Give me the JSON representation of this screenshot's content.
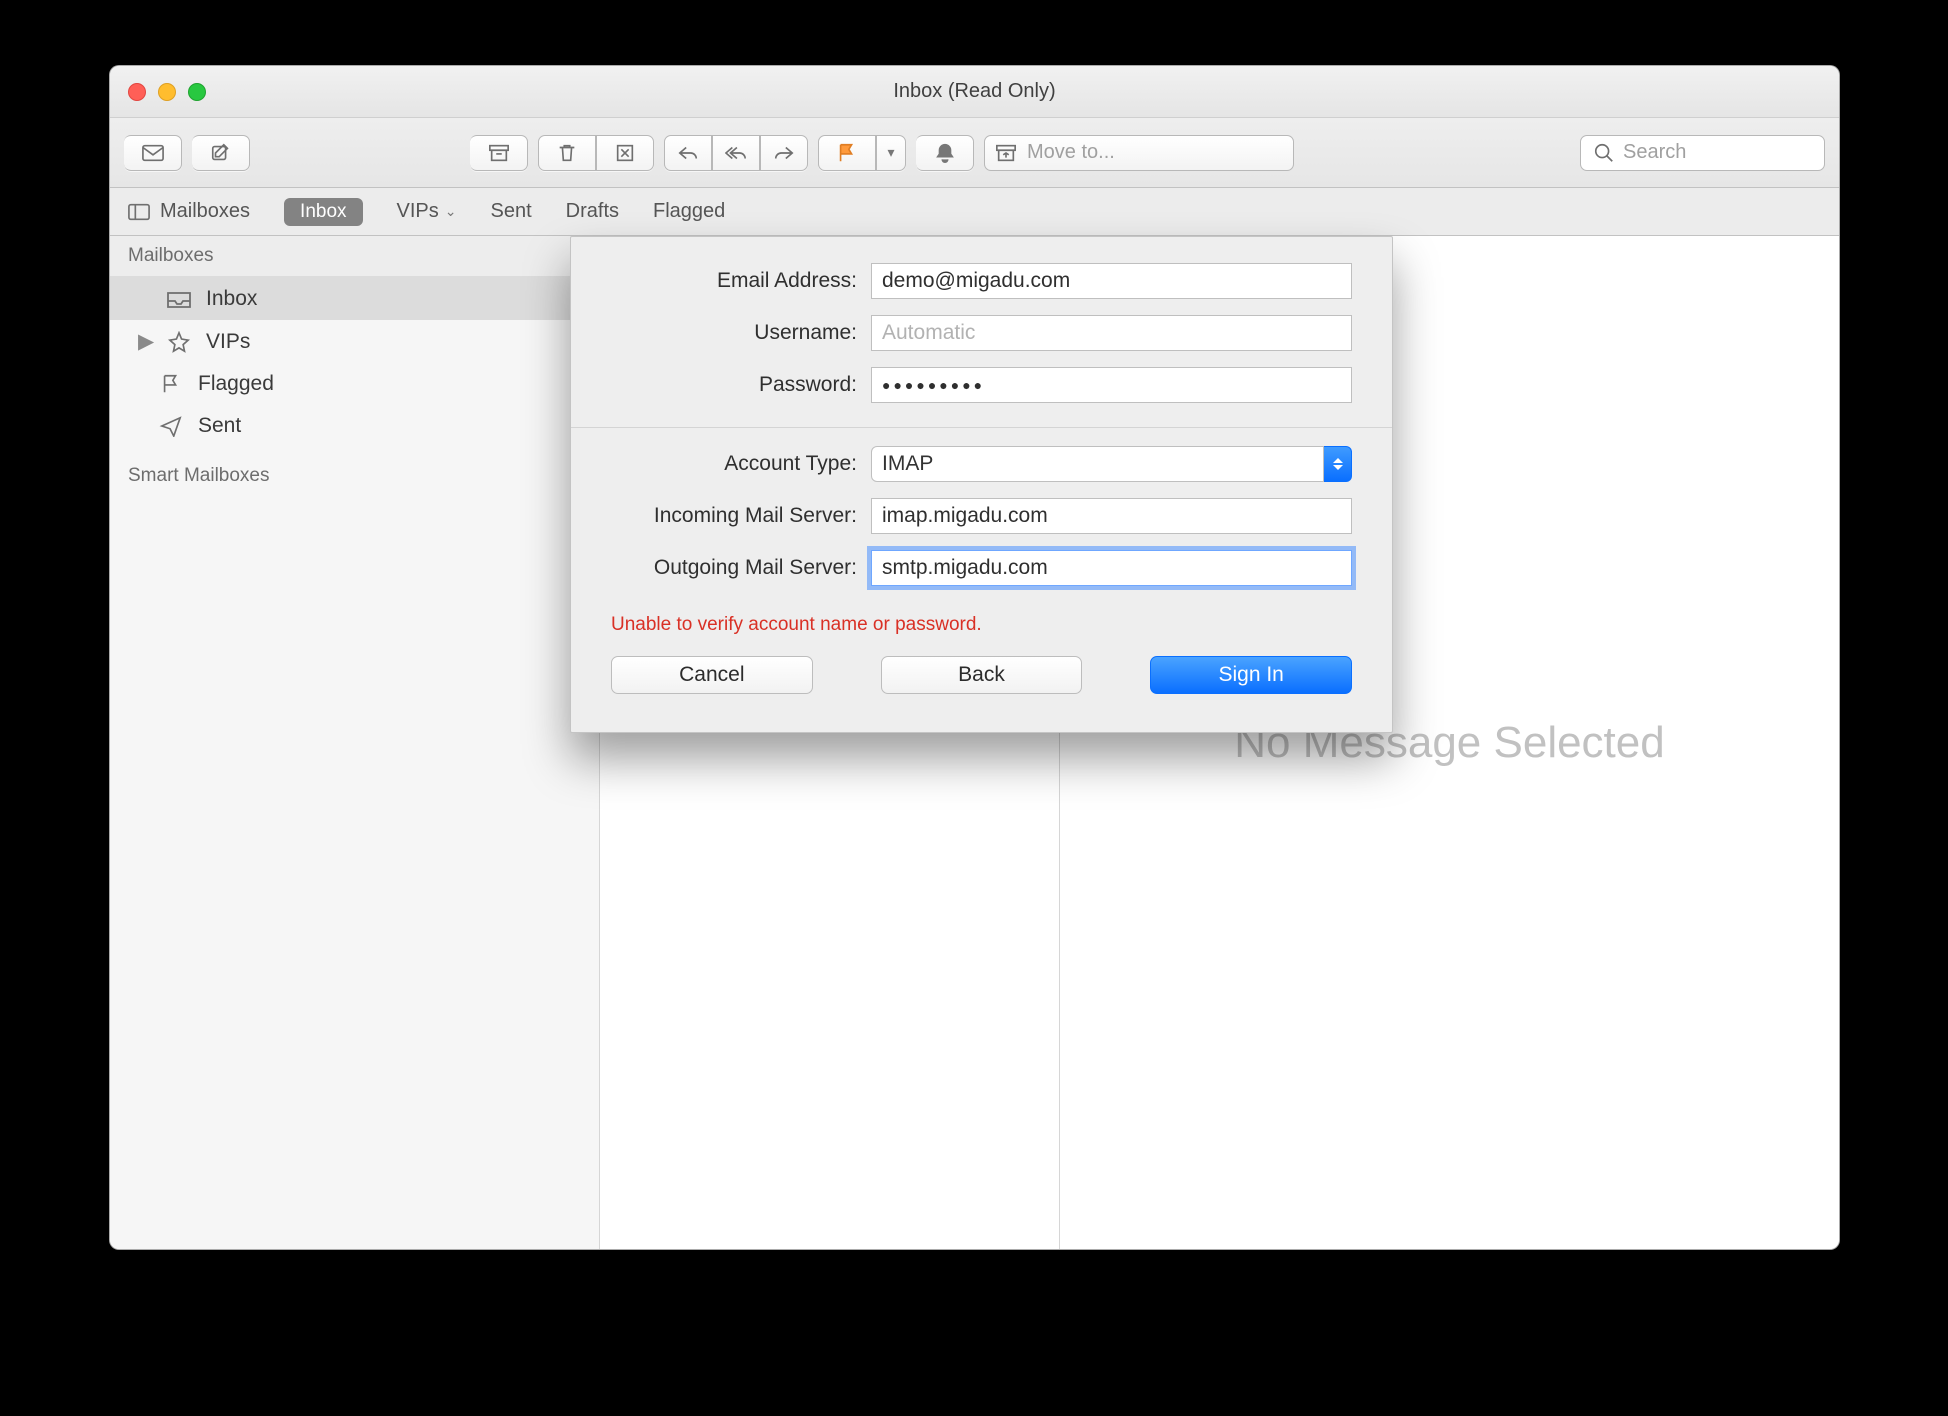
{
  "window": {
    "title": "Inbox (Read Only)"
  },
  "toolbar": {
    "moveToPlaceholder": "Move to...",
    "searchPlaceholder": "Search"
  },
  "favbar": {
    "mailboxes": "Mailboxes",
    "pill": "Inbox",
    "items": [
      {
        "label": "VIPs",
        "hasMenu": true
      },
      {
        "label": "Sent"
      },
      {
        "label": "Drafts"
      },
      {
        "label": "Flagged"
      }
    ]
  },
  "sidebar": {
    "heading": "Mailboxes",
    "items": [
      {
        "label": "Inbox",
        "icon": "inbox",
        "selected": true,
        "caret": false
      },
      {
        "label": "VIPs",
        "icon": "star",
        "caret": true
      },
      {
        "label": "Flagged",
        "icon": "flag",
        "caret": false,
        "indent": true
      },
      {
        "label": "Sent",
        "icon": "sent",
        "caret": false,
        "indent": true
      }
    ],
    "smart": "Smart Mailboxes"
  },
  "preview": {
    "emptyText": "No Message Selected"
  },
  "sheet": {
    "labels": {
      "email": "Email Address:",
      "user": "Username:",
      "pass": "Password:",
      "acct": "Account Type:",
      "inServer": "Incoming Mail Server:",
      "outServer": "Outgoing Mail Server:"
    },
    "values": {
      "email": "demo@migadu.com",
      "userPlaceholder": "Automatic",
      "passMask": "●●●●●●●●●",
      "acct": "IMAP",
      "inServer": "imap.migadu.com",
      "outServer": "smtp.migadu.com"
    },
    "error": "Unable to verify account name or password.",
    "buttons": {
      "cancel": "Cancel",
      "back": "Back",
      "signin": "Sign In"
    }
  }
}
